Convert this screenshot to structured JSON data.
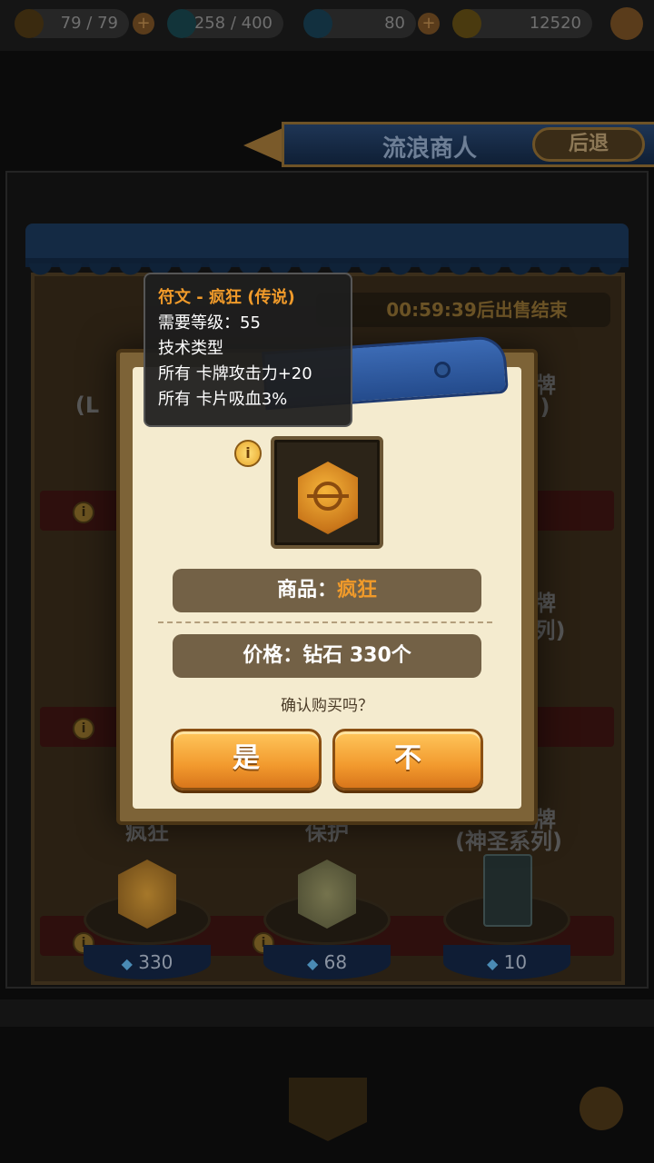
{
  "top_bar": {
    "energy": "79 / 79",
    "potion": "258 / 400",
    "diamonds": "80",
    "gold": "12520",
    "plus": "+"
  },
  "header": {
    "title": "流浪商人",
    "back_label": "后退"
  },
  "shop": {
    "timer": "00:59:39后出售结束",
    "items": [
      {
        "name": "疯狂",
        "price": "330",
        "icon": "gold-rune"
      },
      {
        "name": "保护",
        "price": "68",
        "icon": "olive-rune"
      },
      {
        "name": "(神圣系列)",
        "price": "10",
        "icon": "card-back"
      }
    ],
    "side_labels": {
      "row1_left": "(L",
      "row1_right": "牌",
      "row1_right2": ")",
      "row2_right": "牌",
      "row2_right2": "列)",
      "row3_right": "牌"
    }
  },
  "tooltip": {
    "title": "符文 - 疯狂 (传说)",
    "level": "需要等级：55",
    "type": "技术类型",
    "effect1": "所有 卡牌攻击力+20",
    "effect2": "所有 卡片吸血3%"
  },
  "dialog": {
    "item_prefix": "商品：",
    "item_name": "疯狂",
    "price": "价格：钻石 330个",
    "confirm_question": "确认购买吗？",
    "yes_label": "是",
    "no_label": "不"
  },
  "colors": {
    "accent_orange": "#f09a2a",
    "button_orange": "#f29a2e",
    "dialog_bg": "#f4ebcf",
    "ribbon_blue": "#3c6bb5"
  }
}
